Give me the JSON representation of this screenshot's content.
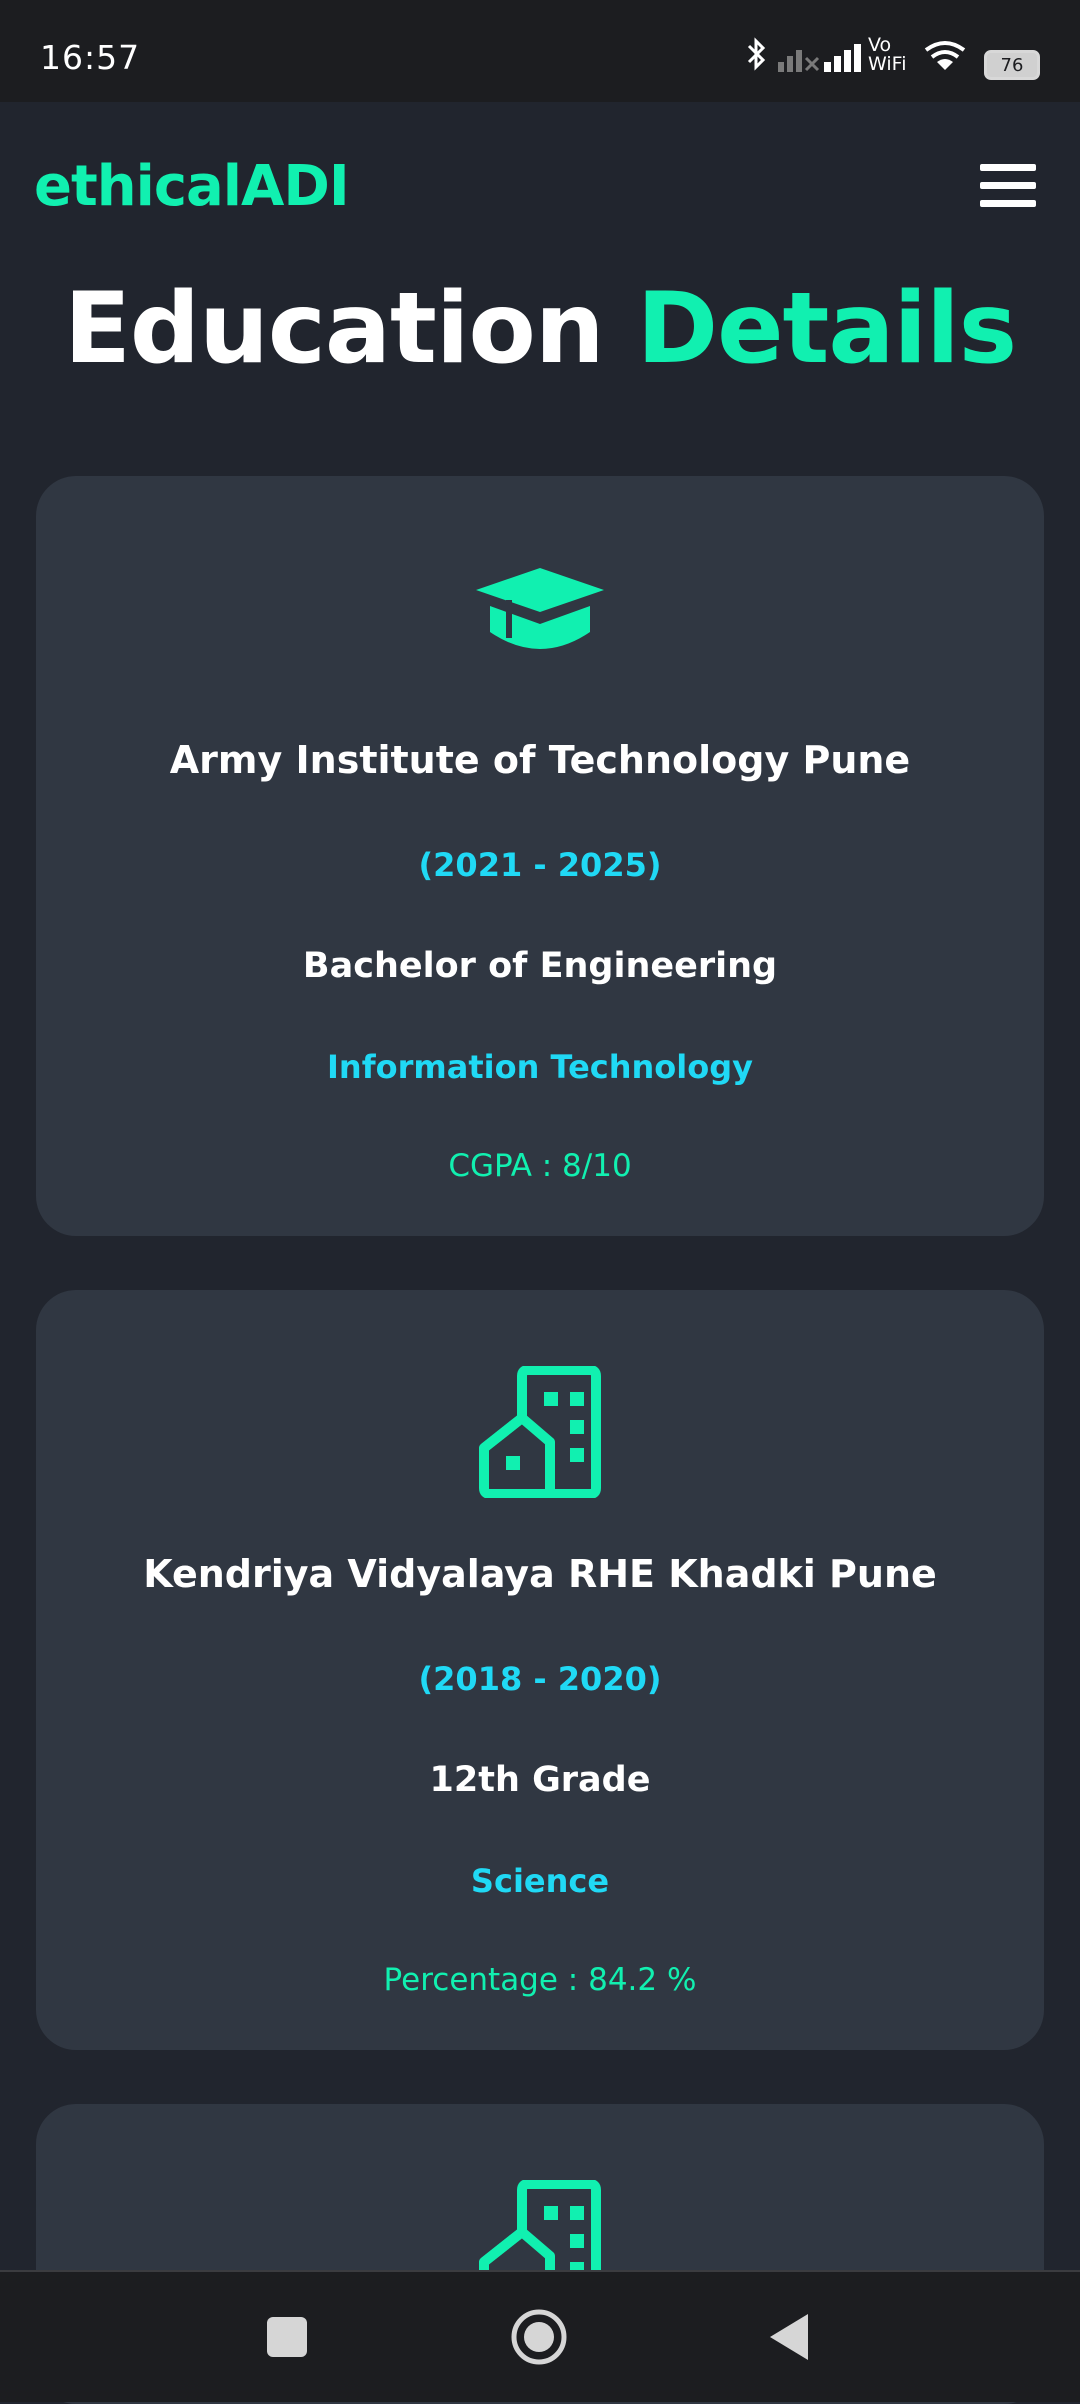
{
  "status_bar": {
    "time": "16:57",
    "battery_level": "76",
    "icons": [
      "bluetooth-icon",
      "signal-weak-icon",
      "signal-icon",
      "vowifi-icon",
      "wifi-icon",
      "battery-icon"
    ],
    "vowifi_top": "Vo",
    "vowifi_bottom": "WiFi"
  },
  "header": {
    "brand": "ethicalADI",
    "menu_icon": "hamburger-menu-icon"
  },
  "page": {
    "title_main": "Education",
    "title_accent": "Details"
  },
  "education": [
    {
      "icon": "graduation-cap-icon",
      "institution": "Army Institute of Technology Pune",
      "years": "(2021 - 2025)",
      "degree": "Bachelor of Engineering",
      "field": "Information Technology",
      "score": "CGPA : 8/10"
    },
    {
      "icon": "school-building-icon",
      "institution": "Kendriya Vidyalaya RHE Khadki Pune",
      "years": "(2018 - 2020)",
      "degree": "12th Grade",
      "field": "Science",
      "score": "Percentage : 84.2 %"
    },
    {
      "icon": "school-building-icon"
    }
  ],
  "system_nav": {
    "icons": [
      "recents-square-icon",
      "home-circle-icon",
      "back-triangle-icon"
    ]
  },
  "colors": {
    "background": "#21252e",
    "card": "#303742",
    "accent_green": "#11f0b0",
    "accent_cyan": "#20d9f5",
    "text_white": "#ffffff"
  }
}
